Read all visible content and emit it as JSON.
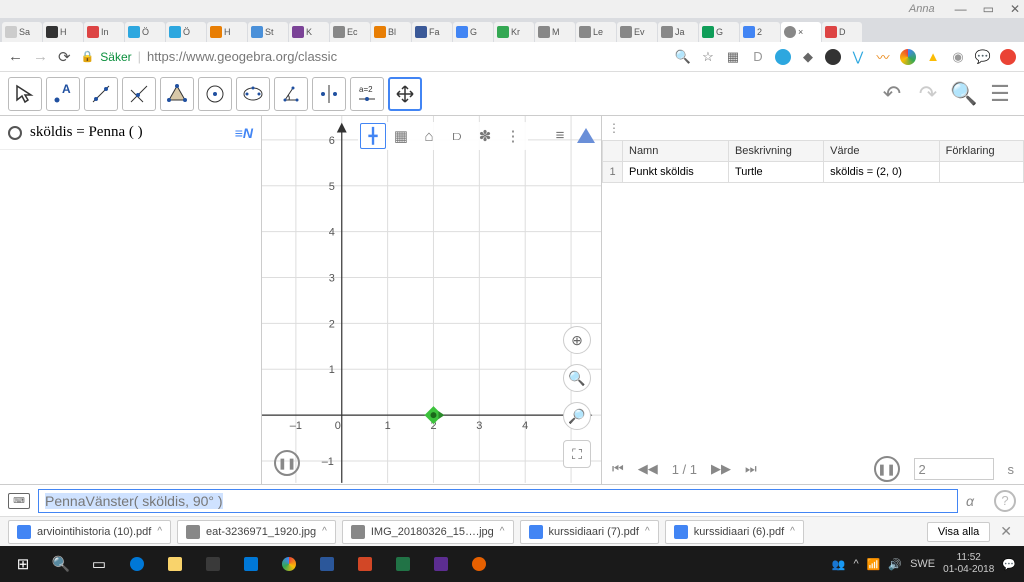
{
  "window": {
    "user": "Anna"
  },
  "browser": {
    "secure_label": "Säker",
    "url": "https://www.geogebra.org/classic",
    "tabs": [
      {
        "label": "Sa",
        "color": "#ccc"
      },
      {
        "label": "H",
        "color": "#333"
      },
      {
        "label": "In",
        "color": "#d44"
      },
      {
        "label": "Ö",
        "color": "#2da7df"
      },
      {
        "label": "Ö",
        "color": "#2da7df"
      },
      {
        "label": "H",
        "color": "#e87e04"
      },
      {
        "label": "St",
        "color": "#4a90d9"
      },
      {
        "label": "K",
        "color": "#7b4397"
      },
      {
        "label": "Ec",
        "color": "#888"
      },
      {
        "label": "Bl",
        "color": "#e87e04"
      },
      {
        "label": "Fa",
        "color": "#3b5998"
      },
      {
        "label": "G",
        "color": "#4285f4"
      },
      {
        "label": "Kr",
        "color": "#34a853"
      },
      {
        "label": "M",
        "color": "#888"
      },
      {
        "label": "Le",
        "color": "#888"
      },
      {
        "label": "Ev",
        "color": "#888"
      },
      {
        "label": "Ja",
        "color": "#888"
      },
      {
        "label": "G",
        "color": "#0f9d58"
      },
      {
        "label": "2",
        "color": "#4285f4"
      },
      {
        "label": "×",
        "color": "#888",
        "active": true
      },
      {
        "label": "D",
        "color": "#d44"
      }
    ]
  },
  "algebra": {
    "expr": "sköldis  =  Penna ( )"
  },
  "sheet": {
    "headers": {
      "name": "Namn",
      "desc": "Beskrivning",
      "value": "Värde",
      "expl": "Förklaring"
    },
    "rows": [
      {
        "n": "1",
        "name": "Punkt sköldis",
        "desc": "Turtle",
        "value": "sköldis = (2, 0)",
        "expl": ""
      }
    ]
  },
  "playback": {
    "pos": "1 / 1",
    "speed": "2",
    "unit": "s"
  },
  "input": {
    "text": "PennaVänster( sköldis, 90° )"
  },
  "downloads": {
    "items": [
      {
        "name": "arviointihistoria (10).pdf"
      },
      {
        "name": "eat-3236971_1920.jpg"
      },
      {
        "name": "IMG_20180326_15….jpg"
      },
      {
        "name": "kurssidiaari (7).pdf"
      },
      {
        "name": "kurssidiaari (6).pdf"
      }
    ],
    "show_all": "Visa alla"
  },
  "taskbar": {
    "lang": "SWE",
    "time": "11:52",
    "date": "01-04-2018"
  },
  "chart_data": {
    "type": "scatter",
    "x": [
      2
    ],
    "y": [
      0
    ],
    "xlabel": "",
    "ylabel": "",
    "xlim": [
      -1.5,
      5
    ],
    "ylim": [
      -1.5,
      6.5
    ],
    "xticks": [
      -1,
      0,
      1,
      2,
      3,
      4
    ],
    "yticks": [
      -1,
      1,
      2,
      3,
      4,
      5,
      6
    ],
    "point_name": "sköldis",
    "point_color": "#3cc23c"
  }
}
